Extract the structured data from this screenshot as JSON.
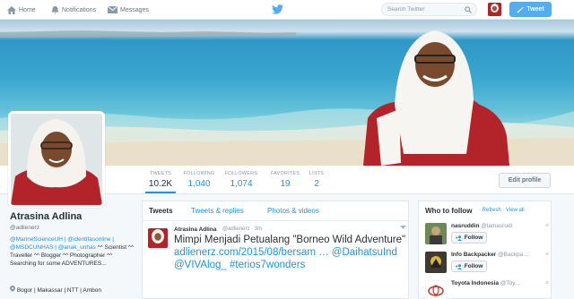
{
  "nav": {
    "home": "Home",
    "notifications": "Notifications",
    "messages": "Messages",
    "search_placeholder": "Search Twitter",
    "tweet_button": "Tweet"
  },
  "stats": [
    {
      "label": "TWEETS",
      "value": "10.2K"
    },
    {
      "label": "FOLLOWING",
      "value": "1,040"
    },
    {
      "label": "FOLLOWERS",
      "value": "1,074"
    },
    {
      "label": "FAVORITES",
      "value": "19"
    },
    {
      "label": "LISTS",
      "value": "2"
    }
  ],
  "edit_profile": "Edit profile",
  "profile": {
    "name": "Atrasina Adlina",
    "handle": "@adlienerz",
    "bio_links1": "@MarineScienceUH | @identifasonline | @MSDCUNHAS | @anak_unhas",
    "bio_after": " ^^ Scientist ^^ Traveller ^^ Blogger ^^ Photographer ^^ Searching for some ADVENTURES...",
    "location": "Bogor | Makassar | NTT | Ambon"
  },
  "timeline": {
    "tabs": [
      "Tweets",
      "Tweets & replies",
      "Photos & videos"
    ],
    "tweet": {
      "name": "Atrasina Adlina",
      "meta": "@adlienerz · 3m",
      "text_plain": "Mimpi Menjadi Petualang \"Borneo Wild Adventure\" ",
      "text_link1": "adlienerz.com/2015/08/bersam …",
      "text_space1": " ",
      "text_link2": "@DaihatsuInd",
      "text_space2": " ",
      "text_link3": "@VIVAlog_",
      "text_space3": " ",
      "text_link4": "#terios7wonders"
    }
  },
  "who_to_follow": {
    "title": "Who to follow",
    "refresh": "Refresh",
    "view_all": "View all",
    "sep": " · ",
    "follow_label": "Follow",
    "close": "×",
    "suggestions": [
      {
        "name": "nasruddin",
        "handle": "@lamasrudi"
      },
      {
        "name": "Info Backpacker",
        "handle": "@Backpa…"
      },
      {
        "name": "Toyota Indonesia",
        "handle": "@Toy…"
      }
    ]
  },
  "colors": {
    "accent": "#55acee",
    "link": "#1b95e0",
    "header_red": "#b3232a"
  }
}
